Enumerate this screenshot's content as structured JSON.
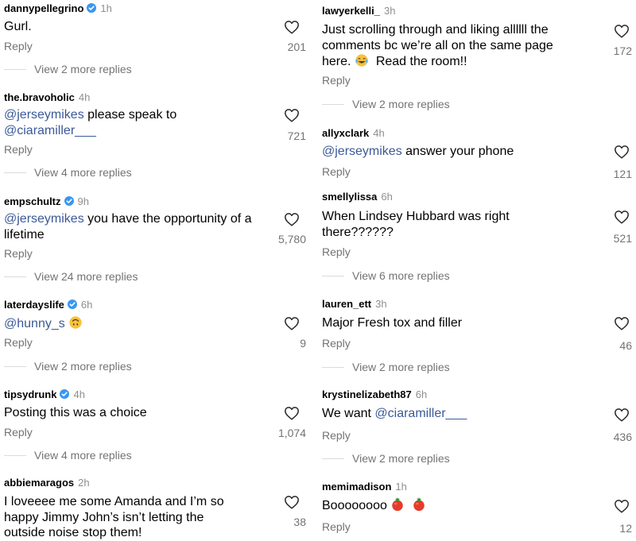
{
  "reply_label": "Reply",
  "accent_color": "#3897f0",
  "left": [
    {
      "user": "dannypellegrino",
      "verified": true,
      "time": "1h",
      "lines": [
        [
          {
            "t": "Gurl."
          }
        ]
      ],
      "likes": "201",
      "view_more": "View 2 more replies"
    },
    {
      "user": "the.bravoholic",
      "verified": false,
      "time": "4h",
      "lines": [
        [
          {
            "t": "@jerseymikes",
            "m": true
          },
          {
            "t": " please speak to"
          }
        ],
        [
          {
            "t": "@ciaramiller___",
            "m": true
          }
        ]
      ],
      "likes": "721",
      "view_more": "View 4 more replies"
    },
    {
      "user": "empschultz",
      "verified": true,
      "time": "9h",
      "lines": [
        [
          {
            "t": "@jerseymikes",
            "m": true
          },
          {
            "t": " you have the opportunity of a"
          }
        ],
        [
          {
            "t": "lifetime"
          }
        ]
      ],
      "likes": "5,780",
      "view_more": "View 24 more replies"
    },
    {
      "user": "laterdayslife",
      "verified": true,
      "time": "6h",
      "lines": [
        [
          {
            "t": "@hunny_s",
            "m": true
          },
          {
            "t": " "
          },
          {
            "e": "upside-down-face-emoji"
          }
        ]
      ],
      "likes": "9",
      "view_more": "View 2 more replies"
    },
    {
      "user": "tipsydrunk",
      "verified": true,
      "time": "4h",
      "lines": [
        [
          {
            "t": "Posting this was a choice"
          }
        ]
      ],
      "likes": "1,074",
      "view_more": "View 4 more replies"
    },
    {
      "user": "abbiemaragos",
      "verified": false,
      "time": "2h",
      "lines": [
        [
          {
            "t": "I loveeee me some Amanda and I’m so"
          }
        ],
        [
          {
            "t": "happy Jimmy John’s isn’t letting the"
          }
        ],
        [
          {
            "t": "outside noise stop them!"
          }
        ]
      ],
      "likes": "38",
      "view_more": ""
    }
  ],
  "right": [
    {
      "user": "lawyerkelli_",
      "verified": false,
      "time": "3h",
      "lines": [
        [
          {
            "t": "Just scrolling through and liking allllll the"
          }
        ],
        [
          {
            "t": "comments bc we’re all on the same page"
          }
        ],
        [
          {
            "t": "here. "
          },
          {
            "e": "laughing-tears-emoji"
          },
          {
            "t": "  Read the room!!"
          }
        ]
      ],
      "likes": "172",
      "view_more": "View 2 more replies"
    },
    {
      "user": "allyxclark",
      "verified": false,
      "time": "4h",
      "lines": [
        [
          {
            "t": "@jerseymikes",
            "m": true
          },
          {
            "t": " answer your phone"
          }
        ]
      ],
      "likes": "121",
      "view_more": ""
    },
    {
      "user": "smellylissa",
      "verified": false,
      "time": "6h",
      "lines": [
        [
          {
            "t": "When Lindsey Hubbard was right"
          }
        ],
        [
          {
            "t": "there??????"
          }
        ]
      ],
      "likes": "521",
      "view_more": "View 6 more replies"
    },
    {
      "user": "lauren_ett",
      "verified": false,
      "time": "3h",
      "lines": [
        [
          {
            "t": "Major Fresh tox and filler"
          }
        ]
      ],
      "likes": "46",
      "view_more": "View 2 more replies"
    },
    {
      "user": "krystinelizabeth87",
      "verified": false,
      "time": "6h",
      "lines": [
        [
          {
            "t": "We want "
          },
          {
            "t": "@ciaramiller___",
            "m": true
          }
        ]
      ],
      "likes": "436",
      "view_more": "View 2 more replies"
    },
    {
      "user": "memimadison",
      "verified": false,
      "time": "1h",
      "lines": [
        [
          {
            "t": "Boooooooo "
          },
          {
            "e": "tomato-emoji"
          },
          {
            "t": "  "
          },
          {
            "e": "tomato-emoji"
          }
        ]
      ],
      "likes": "12",
      "view_more": ""
    }
  ]
}
